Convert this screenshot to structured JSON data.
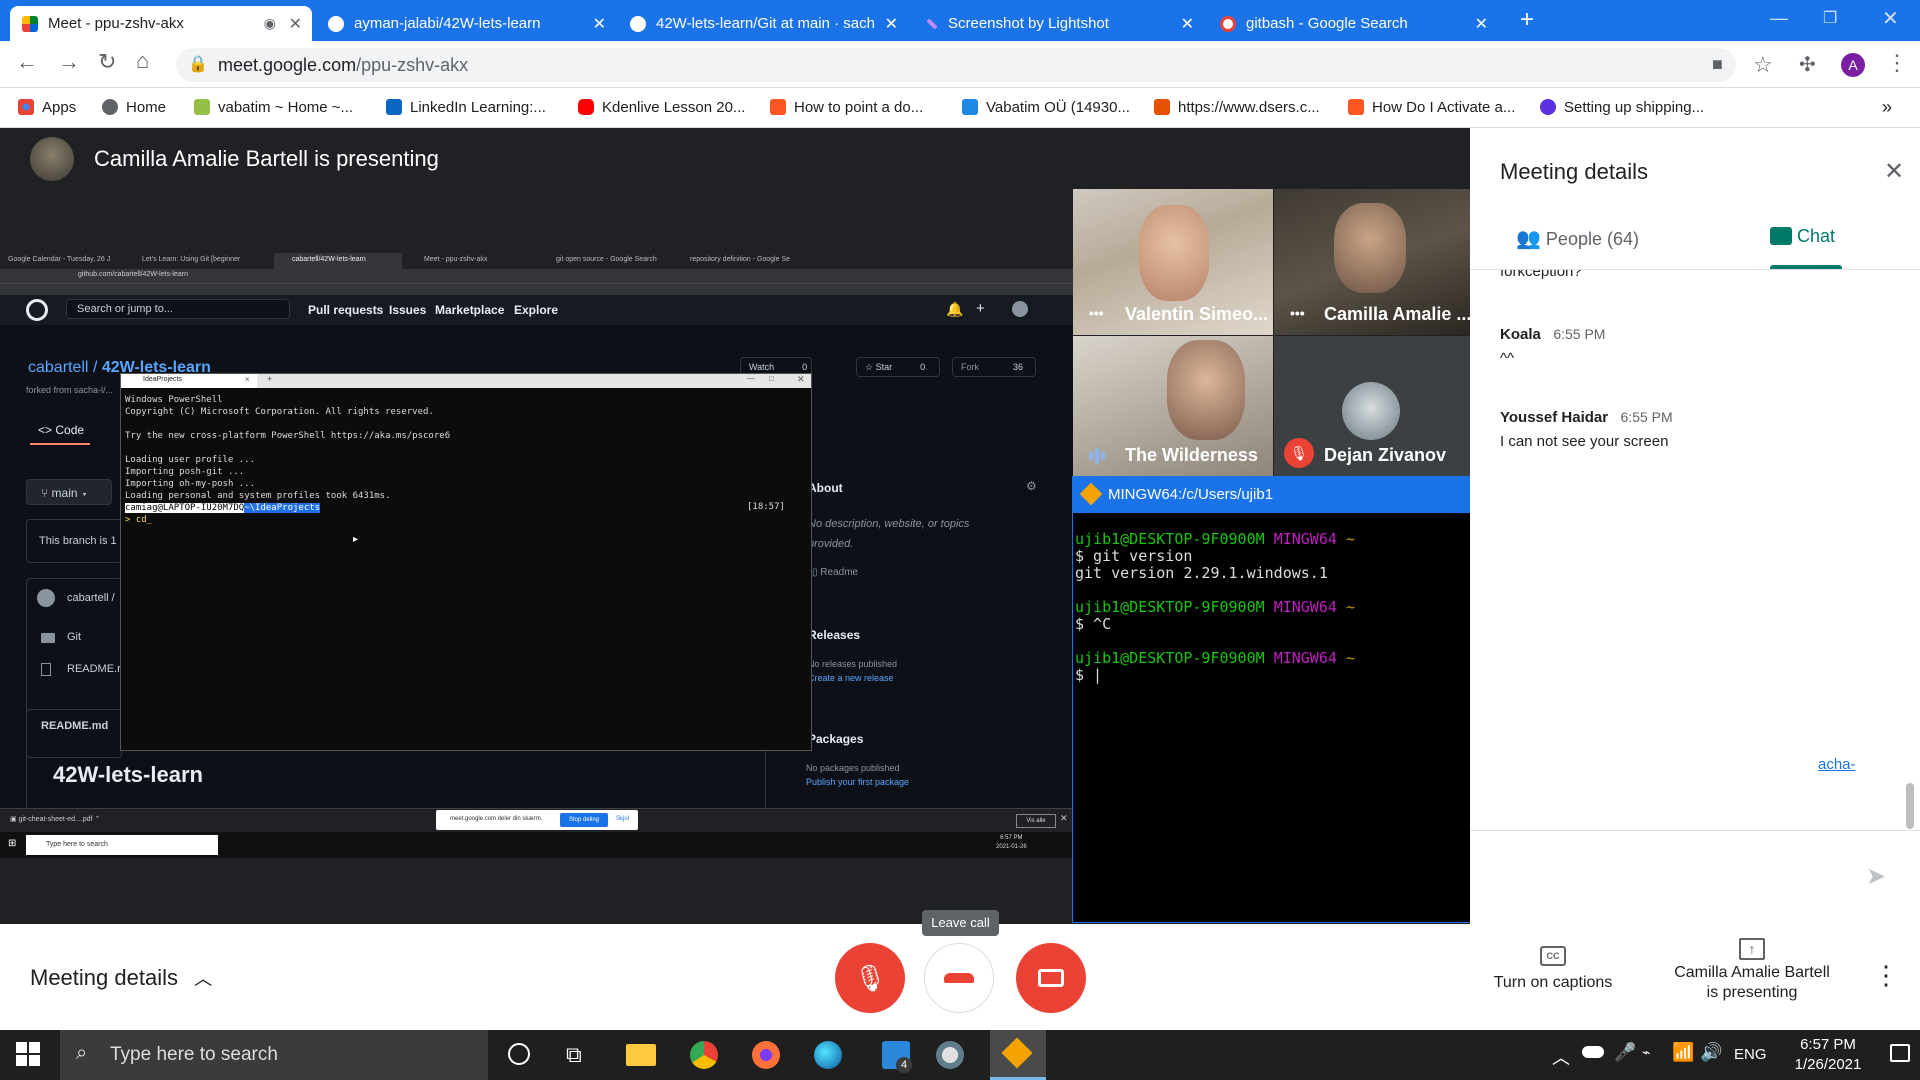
{
  "browser": {
    "tabs": [
      {
        "label": "Meet - ppu-zshv-akx",
        "active": true
      },
      {
        "label": "ayman-jalabi/42W-lets-learn",
        "active": false
      },
      {
        "label": "42W-lets-learn/Git at main · sach",
        "active": false
      },
      {
        "label": "Screenshot by Lightshot",
        "active": false
      },
      {
        "label": "gitbash - Google Search",
        "active": false
      }
    ],
    "new_tab_symbol": "+",
    "url_host": "meet.google.com",
    "url_path": "/ppu-zshv-akx",
    "profile_initial": "A",
    "bookmarks": [
      {
        "label": "Apps",
        "icon": "apps-grid-icon"
      },
      {
        "label": "Home",
        "icon": "home-globe-icon"
      },
      {
        "label": "vabatim ~ Home ~...",
        "icon": "shopify-icon"
      },
      {
        "label": "LinkedIn Learning:...",
        "icon": "linkedin-icon"
      },
      {
        "label": "Kdenlive Lesson 20...",
        "icon": "youtube-icon"
      },
      {
        "label": "How to point a do...",
        "icon": "bookmark-orange-icon"
      },
      {
        "label": "Vabatim OÜ (14930...",
        "icon": "bookmark-blue-icon"
      },
      {
        "label": "https://www.dsers.c...",
        "icon": "dsers-icon"
      },
      {
        "label": "How Do I Activate a...",
        "icon": "bookmark-orange-icon"
      },
      {
        "label": "Setting up shipping...",
        "icon": "bookmark-purple-icon"
      }
    ],
    "bookmarks_overflow": "»",
    "colors": {
      "accent": "#1a73e8",
      "meet_bg": "#202124",
      "danger": "#ea4335"
    }
  },
  "meet": {
    "presenting_banner": "Camilla Amalie Bartell is presenting",
    "participants": [
      {
        "name": "Valentin Simeo...",
        "muted": false
      },
      {
        "name": "Camilla Amalie ...",
        "muted": false
      },
      {
        "name": "The Wilderness",
        "muted": false
      },
      {
        "name": "Dejan Zivanov",
        "muted": true
      }
    ],
    "side_panel": {
      "title": "Meeting details",
      "tab_people": "People (64)",
      "tab_chat": "Chat",
      "messages": [
        {
          "author": "",
          "time": "",
          "text": "forkception?"
        },
        {
          "author": "Koala",
          "time": "6:55 PM",
          "text": "^^"
        },
        {
          "author": "Youssef Haidar",
          "time": "6:55 PM",
          "text": "I can not see your screen"
        }
      ],
      "partial_link": "acha-"
    },
    "bottom_bar": {
      "meeting_details_label": "Meeting details",
      "leave_call_tooltip": "Leave call",
      "captions_label": "Turn on captions",
      "presenting_label_line1": "Camilla Amalie Bartell",
      "presenting_label_line2": "is presenting"
    }
  },
  "shared_screen": {
    "tabs": [
      "Google Calendar - Tuesday, 26 J",
      "Let's Learn: Using Git [beginner",
      "cabartell/42W-lets-learn",
      "Meet - ppu-zshv-akx",
      "git open source - Google Search",
      "repository definition - Google Se"
    ],
    "url": "github.com/cabartell/42W-lets-learn",
    "github": {
      "search_placeholder": "Search or jump to...",
      "nav": [
        "Pull requests",
        "Issues",
        "Marketplace",
        "Explore"
      ],
      "repo_owner": "cabartell",
      "repo_sep": "/",
      "repo_name": "42W-lets-learn",
      "forked_from": "forked from sacha-l/...",
      "watch_label": "Watch",
      "watch_count": "0",
      "star_label": "Star",
      "star_count": "0",
      "fork_label": "Fork",
      "fork_count": "36",
      "code_tab": "<> Code",
      "branch": "main",
      "branch_note": "This branch is 1",
      "commit_author": "cabartell /",
      "files": [
        "Git",
        "README.r"
      ],
      "readme_header": "README.md",
      "readme_title": "42W-lets-learn",
      "about_title": "About",
      "about_desc": "No description, website, or topics provided.",
      "about_readme": "Readme",
      "releases_title": "Releases",
      "releases_none": "No releases published",
      "releases_link": "Create a new release",
      "packages_title": "Packages",
      "packages_none": "No packages published",
      "packages_link": "Publish your first package"
    },
    "powershell": {
      "title": "IdeaProjects",
      "lines": [
        "Windows PowerShell",
        "Copyright (C) Microsoft Corporation. All rights reserved.",
        "",
        "Try the new cross-platform PowerShell https://aka.ms/pscore6",
        "",
        "Loading user profile ...",
        "Importing posh-git ...",
        "Importing oh-my-posh ...",
        "Loading personal and system profiles took 6431ms."
      ],
      "prompt_user": "camiag@LAPTOP-IU20M7DQ",
      "prompt_path": "~\\IdeaProjects",
      "prompt_time": "[18:57]",
      "input": "> cd_"
    },
    "download_file": "git-cheat-sheet-ed....pdf",
    "share_bar_text": "meet.google.com deler din skærm.",
    "share_stop": "Stop deling",
    "share_hide": "Skjul",
    "show_all": "Vis alle",
    "taskbar_search": "Type here to search",
    "clock_time": "6:57 PM",
    "clock_date": "2021-01-26"
  },
  "gitbash": {
    "title": "MINGW64:/c/Users/ujib1",
    "blocks": [
      {
        "user": "ujib1@DESKTOP-9F0900M",
        "env": "MINGW64",
        "path": "~",
        "cmd": "$ git version",
        "out": "git version 2.29.1.windows.1"
      },
      {
        "user": "ujib1@DESKTOP-9F0900M",
        "env": "MINGW64",
        "path": "~",
        "cmd": "$ ^C",
        "out": ""
      },
      {
        "user": "ujib1@DESKTOP-9F0900M",
        "env": "MINGW64",
        "path": "~",
        "cmd": "$ |",
        "out": ""
      }
    ]
  },
  "taskbar": {
    "search_placeholder": "Type here to search",
    "language": "ENG",
    "time": "6:57 PM",
    "date": "1/26/2021",
    "notification_badge": "4"
  }
}
